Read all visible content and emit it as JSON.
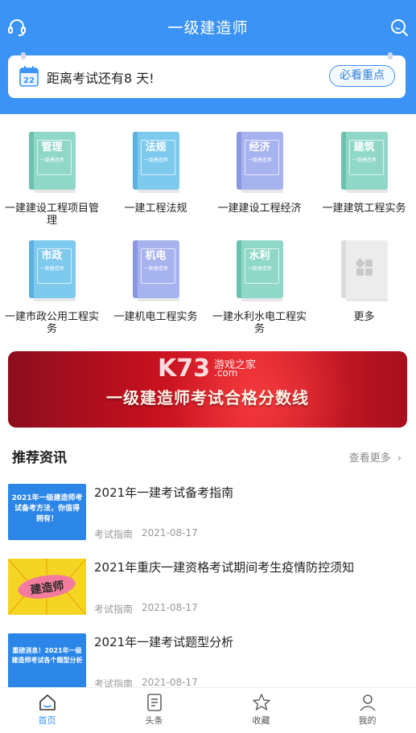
{
  "header": {
    "title": "一级建造师",
    "countdown": "距离考试还有8 天!",
    "calendar_day": "22",
    "focus_button": "必看重点",
    "accent_color": "#3a93f5"
  },
  "categories": [
    {
      "book_title": "管理",
      "book_sub": "一级建造师",
      "label": "一建建设工程项目管理",
      "color": "#8fd8c8"
    },
    {
      "book_title": "法规",
      "book_sub": "一级建造师",
      "label": "一建工程法规",
      "color": "#7ec9ee"
    },
    {
      "book_title": "经济",
      "book_sub": "一级建造师",
      "label": "一建建设工程经济",
      "color": "#a7b3ef"
    },
    {
      "book_title": "建筑",
      "book_sub": "一级建造师",
      "label": "一建建筑工程实务",
      "color": "#8fd8c8"
    },
    {
      "book_title": "市政",
      "book_sub": "一级建造师",
      "label": "一建市政公用工程实务",
      "color": "#7ec9ee"
    },
    {
      "book_title": "机电",
      "book_sub": "一级建造师",
      "label": "一建机电工程实务",
      "color": "#a7b3ef"
    },
    {
      "book_title": "水利",
      "book_sub": "一级建造师",
      "label": "一建水利水电工程实务",
      "color": "#8fd8c8"
    },
    {
      "book_title": "",
      "book_sub": "",
      "label": "更多",
      "color": "#e6e6e6"
    }
  ],
  "banner": {
    "text": "一级建造师考试合格分数线",
    "watermark_logo": "K73",
    "watermark_sub": "游戏之家",
    "watermark_com": ".com"
  },
  "news": {
    "section_title": "推荐资讯",
    "more_label": "查看更多",
    "items": [
      {
        "title": "2021年一建考试备考指南",
        "category": "考试指南",
        "date": "2021-08-17",
        "thumb_text": "2021年一级建造师考试备考方法，你值得拥有！",
        "thumb_color": "#2b86e8"
      },
      {
        "title": "2021年重庆一建资格考试期间考生疫情防控须知",
        "category": "考试指南",
        "date": "2021-08-17",
        "thumb_text": "建造师",
        "thumb_color": "#f5d524"
      },
      {
        "title": "2021年一建考试题型分析",
        "category": "考试指南",
        "date": "2021-08-17",
        "thumb_text": "重磅消息！2021年一级建造师考试各个题型分析",
        "thumb_color": "#2b86e8"
      }
    ]
  },
  "bottom_nav": [
    {
      "label": "首页",
      "icon": "home-icon",
      "active": true
    },
    {
      "label": "头条",
      "icon": "news-icon",
      "active": false
    },
    {
      "label": "收藏",
      "icon": "star-icon",
      "active": false
    },
    {
      "label": "我的",
      "icon": "profile-icon",
      "active": false
    }
  ]
}
